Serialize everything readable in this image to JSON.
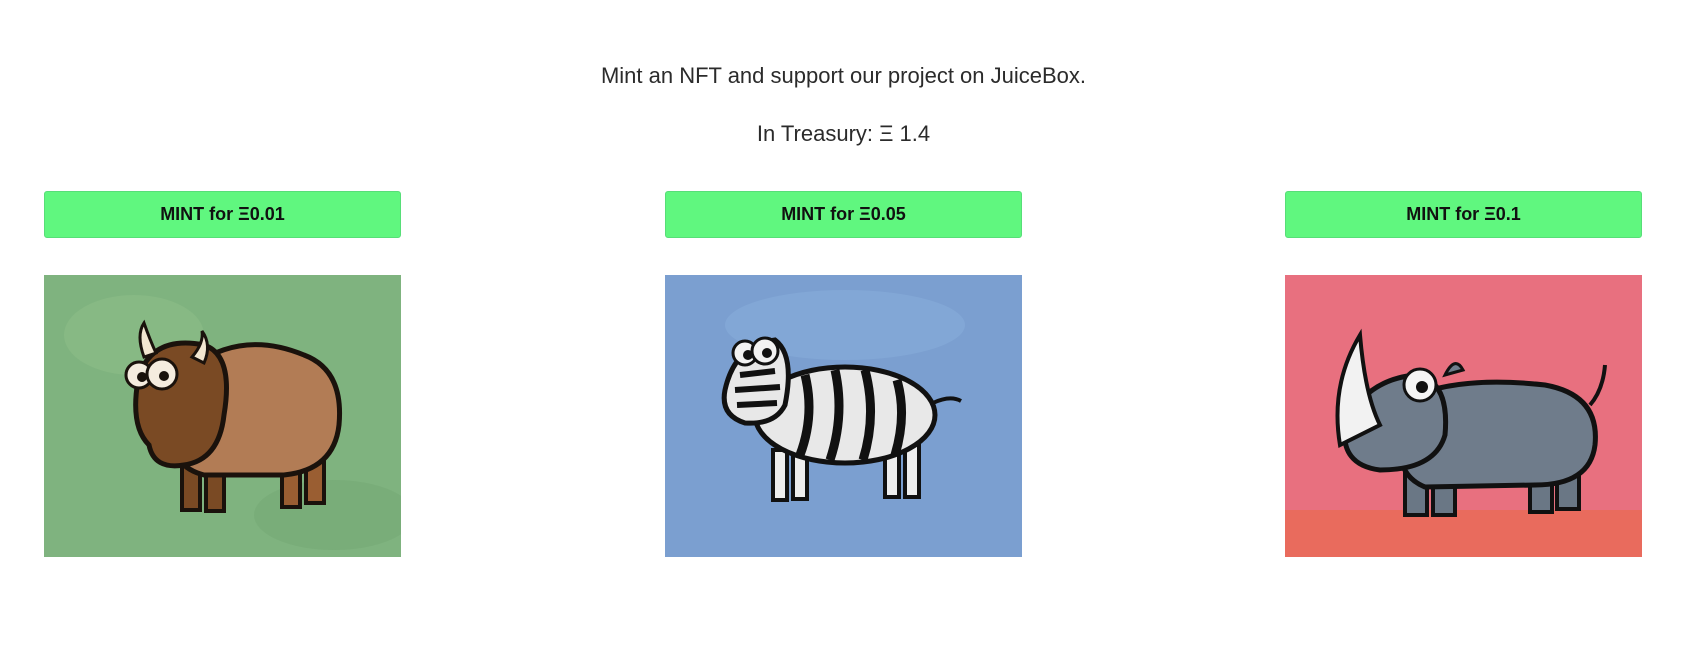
{
  "intro": {
    "text": "Mint an NFT and support our project on JuiceBox."
  },
  "treasury": {
    "text": "In Treasury: Ξ 1.4"
  },
  "mints": [
    {
      "button_label": "MINT for Ξ0.01",
      "animal": "bison",
      "background_color": "#7fb37f"
    },
    {
      "button_label": "MINT for Ξ0.05",
      "animal": "zebra",
      "background_color": "#7b9fd0"
    },
    {
      "button_label": "MINT for Ξ0.1",
      "animal": "rhino",
      "background_color": "#e8707f"
    }
  ],
  "colors": {
    "button": "#60f77f",
    "text": "#2b2b2b"
  }
}
